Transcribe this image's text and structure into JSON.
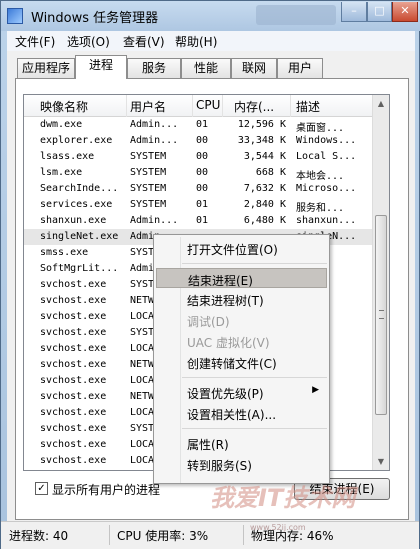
{
  "window": {
    "title": "Windows 任务管理器"
  },
  "menubar": [
    "文件(F)",
    "选项(O)",
    "查看(V)",
    "帮助(H)"
  ],
  "tabs": [
    "应用程序",
    "进程",
    "服务",
    "性能",
    "联网",
    "用户"
  ],
  "active_tab": "进程",
  "columns": [
    "映像名称",
    "用户名",
    "CPU",
    "内存(...",
    "描述"
  ],
  "rows": [
    [
      "dwm.exe",
      "Admin...",
      "01",
      "12,596 K",
      "桌面窗..."
    ],
    [
      "explorer.exe",
      "Admin...",
      "00",
      "33,348 K",
      "Windows..."
    ],
    [
      "lsass.exe",
      "SYSTEM",
      "00",
      "3,544 K",
      "Local S..."
    ],
    [
      "lsm.exe",
      "SYSTEM",
      "00",
      "668 K",
      "本地会..."
    ],
    [
      "SearchInde...",
      "SYSTEM",
      "00",
      "7,632 K",
      "Microso..."
    ],
    [
      "services.exe",
      "SYSTEM",
      "01",
      "2,840 K",
      "服务和..."
    ],
    [
      "shanxun.exe",
      "Admin...",
      "01",
      "6,480 K",
      "shanxun..."
    ],
    [
      "singleNet.exe",
      "Admin...",
      "",
      "",
      "singleN..."
    ],
    [
      "smss.exe",
      "SYST",
      "",
      "",
      ""
    ],
    [
      "SoftMgrLit...",
      "Admin",
      "",
      "",
      ""
    ],
    [
      "svchost.exe",
      "SYST",
      "",
      "",
      ""
    ],
    [
      "svchost.exe",
      "NETW",
      "",
      "",
      ""
    ],
    [
      "svchost.exe",
      "LOCA",
      "",
      "",
      ""
    ],
    [
      "svchost.exe",
      "SYST",
      "",
      "",
      ""
    ],
    [
      "svchost.exe",
      "LOCA",
      "",
      "",
      ""
    ],
    [
      "svchost.exe",
      "NETW",
      "",
      "",
      ""
    ],
    [
      "svchost.exe",
      "LOCA",
      "",
      "",
      ""
    ],
    [
      "svchost.exe",
      "NETW",
      "",
      "",
      ""
    ],
    [
      "svchost.exe",
      "LOCA",
      "",
      "",
      ""
    ],
    [
      "svchost.exe",
      "SYST",
      "",
      "",
      ""
    ],
    [
      "svchost.exe",
      "LOCA",
      "",
      "",
      ""
    ],
    [
      "svchost.exe",
      "LOCA",
      "",
      "",
      ""
    ]
  ],
  "context_menu": [
    {
      "label": "打开文件位置(O)",
      "state": "normal"
    },
    {
      "sep": true
    },
    {
      "label": "结束进程(E)",
      "state": "hover"
    },
    {
      "label": "结束进程树(T)",
      "state": "normal"
    },
    {
      "label": "调试(D)",
      "state": "disabled"
    },
    {
      "label": "UAC 虚拟化(V)",
      "state": "disabled"
    },
    {
      "label": "创建转储文件(C)",
      "state": "normal"
    },
    {
      "sep": true
    },
    {
      "label": "设置优先级(P)",
      "state": "normal",
      "submenu": true
    },
    {
      "label": "设置相关性(A)...",
      "state": "normal"
    },
    {
      "sep": true
    },
    {
      "label": "属性(R)",
      "state": "normal"
    },
    {
      "label": "转到服务(S)",
      "state": "normal"
    }
  ],
  "show_all_users": {
    "label": "显示所有用户的进程",
    "checked": true,
    "check_glyph": "✓"
  },
  "end_button": "结束进程(E)",
  "status": {
    "processes": "进程数: 40",
    "cpu": "CPU 使用率: 3%",
    "memory": "物理内存: 46%"
  },
  "watermark": {
    "text": "我爱IT技术网",
    "sub": "www.52ij.com"
  },
  "colors": {
    "highlight_row": "#e6e6e6",
    "menu_hover": "#c7c4c0"
  }
}
